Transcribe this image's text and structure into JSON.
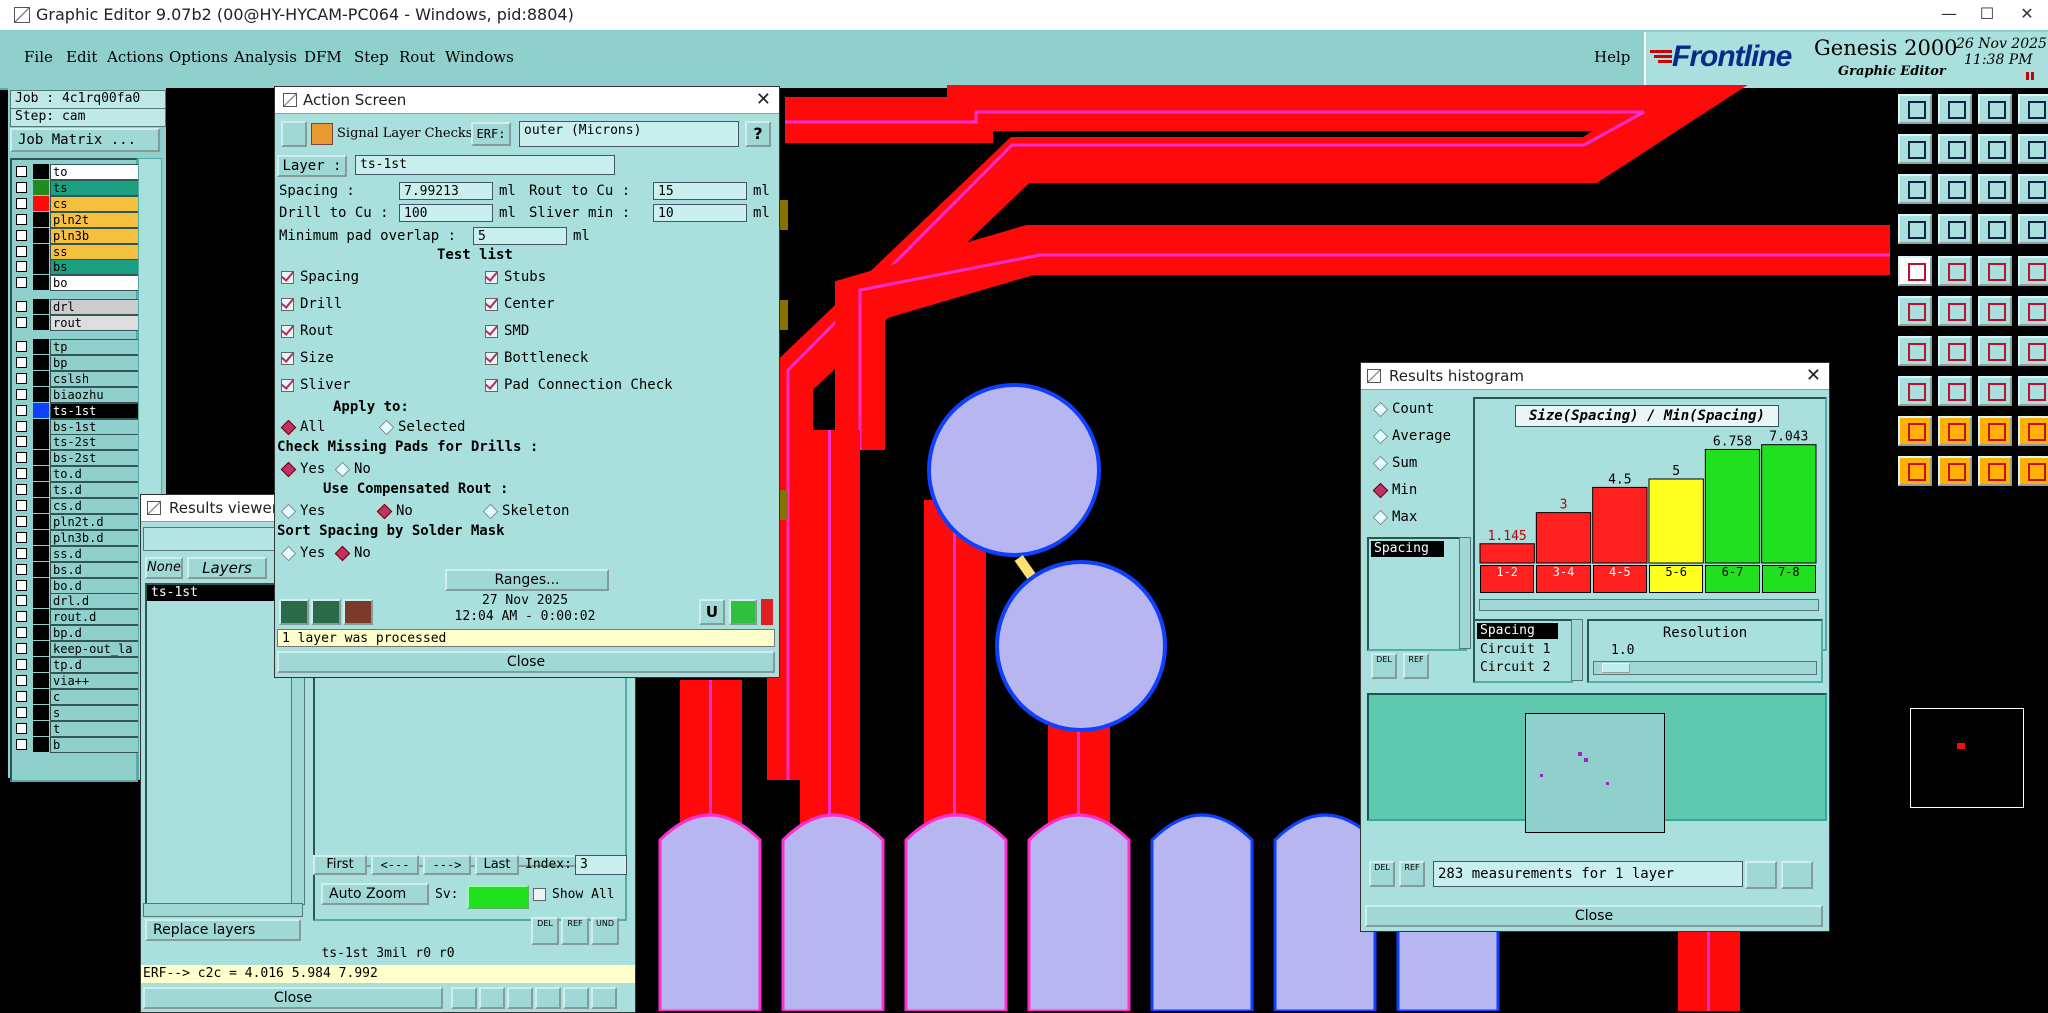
{
  "window": {
    "title": "Graphic Editor 9.07b2 (00@HY-HYCAM-PC064 - Windows, pid:8804)",
    "min": "—",
    "max": "☐",
    "close": "✕"
  },
  "menu": {
    "items": [
      "File",
      "Edit",
      "Actions",
      "Options",
      "Analysis",
      "DFM",
      "Step",
      "Rout",
      "Windows"
    ],
    "help": "Help"
  },
  "brand": {
    "logo": "Frontline",
    "product": "Genesis 2000",
    "subtitle": "Graphic Editor",
    "date": "26 Nov 2025",
    "time": "11:38 PM"
  },
  "left": {
    "job": "Job : 4c1rq00fa0",
    "step": "Step: cam",
    "matrix_button": "Job Matrix ...",
    "layers": [
      {
        "name": "to",
        "color": "#ffffff",
        "swatch": "#000000"
      },
      {
        "name": "ts",
        "color": "#1aa080",
        "swatch": "#1e8c1e"
      },
      {
        "name": "cs",
        "color": "#f5c040",
        "swatch": "#ff0a0a"
      },
      {
        "name": "pln2t",
        "color": "#f5c040",
        "swatch": "#000000"
      },
      {
        "name": "pln3b",
        "color": "#f5c040",
        "swatch": "#000000"
      },
      {
        "name": "ss",
        "color": "#f5c040",
        "swatch": "#000000"
      },
      {
        "name": "bs",
        "color": "#1aa080",
        "swatch": "#000000"
      },
      {
        "name": "bo",
        "color": "#ffffff",
        "swatch": "#000000"
      },
      {
        "name": "drl",
        "color": "#cccccc",
        "swatch": "#000000"
      },
      {
        "name": "rout",
        "color": "#dddddd",
        "swatch": "#000000"
      },
      {
        "name": "tp",
        "color": "#8fd0cc",
        "swatch": "#000000"
      },
      {
        "name": "bp",
        "color": "#8fd0cc",
        "swatch": "#000000"
      },
      {
        "name": "cslsh",
        "color": "#8fd0cc",
        "swatch": "#000000"
      },
      {
        "name": "biaozhu",
        "color": "#8fd0cc",
        "swatch": "#000000"
      },
      {
        "name": "ts-1st",
        "color": "#000000",
        "swatch": "#1040ff"
      },
      {
        "name": "bs-1st",
        "color": "#8fd0cc",
        "swatch": "#000000"
      },
      {
        "name": "ts-2st",
        "color": "#8fd0cc",
        "swatch": "#000000"
      },
      {
        "name": "bs-2st",
        "color": "#8fd0cc",
        "swatch": "#000000"
      },
      {
        "name": "to.d",
        "color": "#8fd0cc",
        "swatch": "#000000"
      },
      {
        "name": "ts.d",
        "color": "#8fd0cc",
        "swatch": "#000000"
      },
      {
        "name": "cs.d",
        "color": "#8fd0cc",
        "swatch": "#000000"
      },
      {
        "name": "pln2t.d",
        "color": "#8fd0cc",
        "swatch": "#000000"
      },
      {
        "name": "pln3b.d",
        "color": "#8fd0cc",
        "swatch": "#000000"
      },
      {
        "name": "ss.d",
        "color": "#8fd0cc",
        "swatch": "#000000"
      },
      {
        "name": "bs.d",
        "color": "#8fd0cc",
        "swatch": "#000000"
      },
      {
        "name": "bo.d",
        "color": "#8fd0cc",
        "swatch": "#000000"
      },
      {
        "name": "drl.d",
        "color": "#8fd0cc",
        "swatch": "#000000"
      },
      {
        "name": "rout.d",
        "color": "#8fd0cc",
        "swatch": "#000000"
      },
      {
        "name": "bp.d",
        "color": "#8fd0cc",
        "swatch": "#000000"
      },
      {
        "name": "keep-out_la",
        "color": "#8fd0cc",
        "swatch": "#000000"
      },
      {
        "name": "tp.d",
        "color": "#8fd0cc",
        "swatch": "#000000"
      },
      {
        "name": "via++",
        "color": "#8fd0cc",
        "swatch": "#000000"
      },
      {
        "name": "c",
        "color": "#8fd0cc",
        "swatch": "#000000"
      },
      {
        "name": "s",
        "color": "#8fd0cc",
        "swatch": "#000000"
      },
      {
        "name": "t",
        "color": "#8fd0cc",
        "swatch": "#000000"
      },
      {
        "name": "b",
        "color": "#8fd0cc",
        "swatch": "#000000"
      }
    ]
  },
  "results_viewer": {
    "title": "Results viewer",
    "tab_none": "None",
    "tab_layers": "Layers",
    "selected_layer": "ts-1st",
    "nav": {
      "first": "First",
      "prev": "<---",
      "next": "--->",
      "last": "Last",
      "index_label": "Index:",
      "index_value": "3"
    },
    "auto_zoom": "Auto Zoom",
    "sv": "Sv:",
    "show_all": "Show All",
    "replace_layers": "Replace layers",
    "status_line": "ts-1st 3mil  r0  r0",
    "erf_line": "ERF--> c2c = 4.016 5.984 7.992",
    "close": "Close"
  },
  "action_screen": {
    "title": "Action Screen",
    "header_label": "Signal Layer Checks",
    "erf_label": "ERF:",
    "erf_value": "outer (Microns)",
    "help": "?",
    "layer_label": "Layer :",
    "layer_value": "ts-1st",
    "spacing_label": "Spacing      :",
    "spacing_value": "7.99213",
    "rout_cu_label": "Rout to Cu  :",
    "rout_cu_value": "15",
    "drill_cu_label": "Drill to Cu :",
    "drill_cu_value": "100",
    "sliver_label": "Sliver min  :",
    "sliver_value": "10",
    "unit": "ml",
    "min_pad_label": "Minimum pad overlap :",
    "min_pad_value": "5",
    "test_list_label": "Test list",
    "tests_left": [
      "Spacing",
      "Drill",
      "Rout",
      "Size",
      "Sliver"
    ],
    "tests_right": [
      "Stubs",
      "Center",
      "SMD",
      "Bottleneck",
      "Pad Connection Check"
    ],
    "apply_label": "Apply to:",
    "apply_all": "All",
    "apply_selected": "Selected",
    "missing_label": "Check Missing Pads for Drills :",
    "yes": "Yes",
    "no": "No",
    "comp_label": "Use Compensated Rout :",
    "skeleton": "Skeleton",
    "sort_label": "Sort Spacing by Solder Mask",
    "ranges": "Ranges...",
    "date": "27 Nov 2025",
    "time": "12:04 AM - 0:00:02",
    "status": "1 layer was processed",
    "close": "Close",
    "u_btn": "U"
  },
  "histogram": {
    "title": "Results histogram",
    "options": [
      "Count",
      "Average",
      "Sum",
      "Min",
      "Max"
    ],
    "selected_option": "Min",
    "list_item": "Spacing",
    "chart_title": "Size(Spacing) / Min(Spacing)",
    "resolution_label": "Resolution",
    "resolution_value": "1.0",
    "categories_list": [
      "Spacing",
      "Circuit 1",
      "Circuit 2"
    ],
    "measurements": "283 measurements for 1 layer",
    "close": "Close",
    "del": "DEL",
    "ref": "REF"
  },
  "chart_data": {
    "type": "bar",
    "title": "Size(Spacing) / Min(Spacing)",
    "categories": [
      "1-2",
      "3-4",
      "4-5",
      "5-6",
      "6-7",
      "7-8"
    ],
    "values": [
      1.145,
      3,
      4.5,
      5,
      6.758,
      7.043
    ],
    "labels": [
      "1.145",
      "3",
      "4.5",
      "5",
      "6.758",
      "7.043"
    ],
    "colors": [
      "#ff2020",
      "#ff2020",
      "#ff2020",
      "#ffff20",
      "#20e020",
      "#20e020"
    ],
    "ylim": [
      0,
      8
    ]
  }
}
